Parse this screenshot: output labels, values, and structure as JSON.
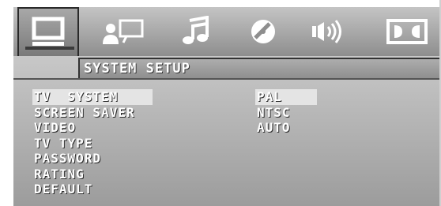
{
  "header": {
    "tabs": [
      {
        "icon": "monitor-icon",
        "active": true
      },
      {
        "icon": "person-screen-icon",
        "active": false
      },
      {
        "icon": "music-note-icon",
        "active": false
      },
      {
        "icon": "disc-icon",
        "active": false
      },
      {
        "icon": "speaker-icon",
        "active": false
      },
      {
        "icon": "dolby-icon",
        "active": false
      }
    ]
  },
  "title": "SYSTEM SETUP",
  "menu": {
    "items": [
      "TV  SYSTEM",
      "SCREEN SAVER",
      "VIDEO",
      "TV TYPE",
      "PASSWORD",
      "RATING",
      "DEFAULT"
    ],
    "selected_index": 0
  },
  "options": {
    "items": [
      "PAL",
      "NTSC",
      "AUTO"
    ],
    "selected_index": 0
  },
  "colors": {
    "text": "#ffffff",
    "highlight": "#e4e4e4",
    "icon": "#ffffff"
  }
}
